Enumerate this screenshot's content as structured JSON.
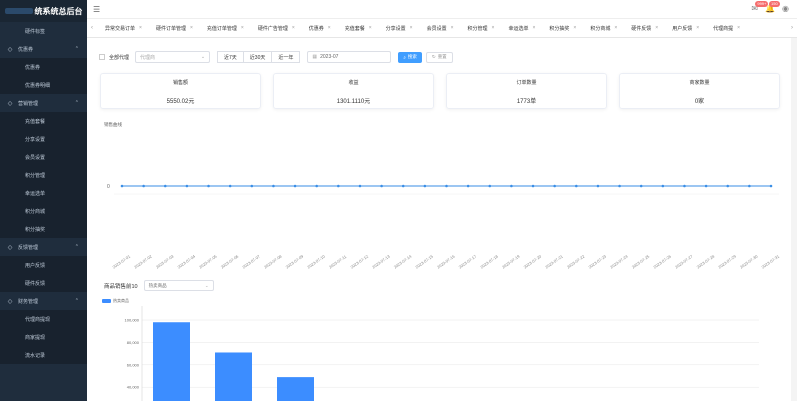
{
  "app": {
    "title": "统系统总后台"
  },
  "sidebar": {
    "items": [
      {
        "type": "item",
        "label": "硬件标签"
      },
      {
        "type": "group",
        "label": "优惠券",
        "icon": "tag-icon"
      },
      {
        "type": "item",
        "label": "优惠券"
      },
      {
        "type": "item",
        "label": "优惠券明细"
      },
      {
        "type": "group",
        "label": "营销管理",
        "icon": "target-icon"
      },
      {
        "type": "item",
        "label": "充值套餐"
      },
      {
        "type": "item",
        "label": "分享设置"
      },
      {
        "type": "item",
        "label": "会员设置"
      },
      {
        "type": "item",
        "label": "积分管理"
      },
      {
        "type": "item",
        "label": "幸运选单"
      },
      {
        "type": "item",
        "label": "积分商城"
      },
      {
        "type": "item",
        "label": "积分抽奖"
      },
      {
        "type": "group",
        "label": "反馈管理",
        "icon": "feedback-icon"
      },
      {
        "type": "item",
        "label": "用户反馈"
      },
      {
        "type": "item",
        "label": "硬件反馈"
      },
      {
        "type": "group",
        "label": "财务管理",
        "icon": "finance-icon"
      },
      {
        "type": "item",
        "label": "代理商提现"
      },
      {
        "type": "item",
        "label": "商家提现"
      },
      {
        "type": "item",
        "label": "流水记录"
      }
    ]
  },
  "header": {
    "badge1": "999+",
    "badge2": "150"
  },
  "tabs": [
    "异常交易订单",
    "硬件订单管理",
    "充值订单管理",
    "硬件广告管理",
    "优惠券",
    "充值套餐",
    "分享设置",
    "会员设置",
    "积分管理",
    "幸运选单",
    "积分抽奖",
    "积分商城",
    "硬件反馈",
    "用户反馈",
    "代理商提"
  ],
  "filter": {
    "checkbox_label": "全部代理",
    "select_placeholder": "代理商",
    "btn_7": "近7天",
    "btn_30": "近30天",
    "btn_year": "近一年",
    "date_value": "2023-07",
    "search_label": "搜索",
    "reset_label": "重置"
  },
  "cards": [
    {
      "title": "销售额",
      "value": "5550.02元"
    },
    {
      "title": "收益",
      "value": "1301.1110元"
    },
    {
      "title": "订单数量",
      "value": "1773单"
    },
    {
      "title": "商家数量",
      "value": "0家"
    }
  ],
  "line_section": {
    "title": "销售曲线"
  },
  "bar_section": {
    "title": "商品销售前10",
    "select_value": "热卖商品",
    "legend": "热卖商品"
  },
  "chart_data": [
    {
      "type": "line",
      "x": [
        "2023-07-01",
        "2023-07-02",
        "2023-07-03",
        "2023-07-04",
        "2023-07-05",
        "2023-07-06",
        "2023-07-07",
        "2023-07-08",
        "2023-07-09",
        "2023-07-10",
        "2023-07-11",
        "2023-07-12",
        "2023-07-13",
        "2023-07-14",
        "2023-07-15",
        "2023-07-16",
        "2023-07-17",
        "2023-07-18",
        "2023-07-19",
        "2023-07-20",
        "2023-07-21",
        "2023-07-22",
        "2023-07-23",
        "2023-07-24",
        "2023-07-25",
        "2023-07-26",
        "2023-07-27",
        "2023-07-28",
        "2023-07-29",
        "2023-07-30",
        "2023-07-31"
      ],
      "series": [
        {
          "values": [
            0,
            0,
            0,
            0,
            0,
            0,
            0,
            0,
            0,
            0,
            0,
            0,
            0,
            0,
            0,
            0,
            0,
            0,
            0,
            0,
            0,
            0,
            0,
            0,
            0,
            0,
            0,
            0,
            0,
            0,
            0
          ]
        }
      ],
      "yticks": [
        "0"
      ],
      "color": "#3a8ee6"
    },
    {
      "type": "bar",
      "series": [
        {
          "name": "热卖商品",
          "values": [
            98000,
            71000,
            49000
          ]
        }
      ],
      "yticks": [
        "100,000",
        "80,000",
        "60,000",
        "40,000"
      ],
      "ylim": [
        0,
        100000
      ],
      "color": "#3c8dff"
    }
  ]
}
